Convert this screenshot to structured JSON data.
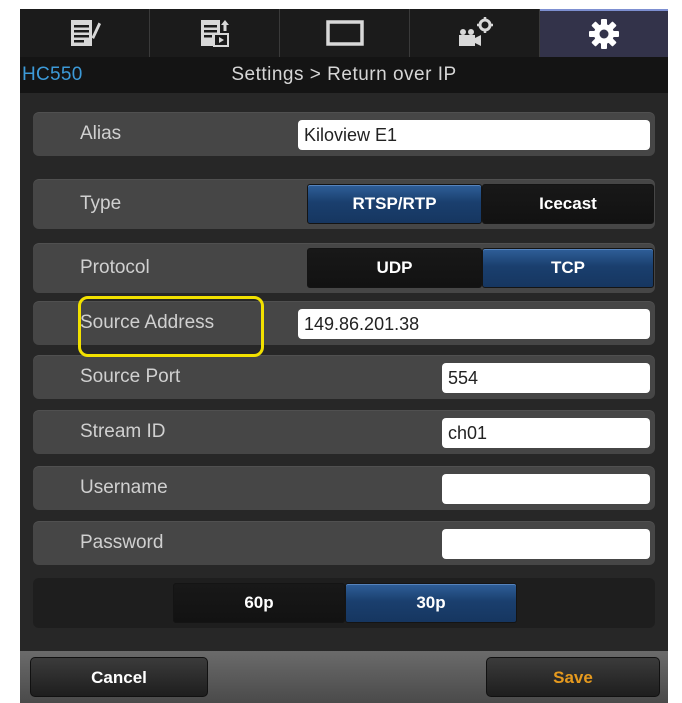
{
  "tabs": [
    {
      "icon": "list-edit-icon"
    },
    {
      "icon": "list-export-icon"
    },
    {
      "icon": "monitor-icon"
    },
    {
      "icon": "camera-settings-icon"
    },
    {
      "icon": "gear-icon",
      "active": true
    }
  ],
  "header": {
    "model": "HC550",
    "title": "Settings > Return over IP"
  },
  "fields": {
    "alias": {
      "label": "Alias",
      "value": "Kiloview E1"
    },
    "type": {
      "label": "Type",
      "options": [
        "RTSP/RTP",
        "Icecast"
      ],
      "selected": "RTSP/RTP"
    },
    "protocol": {
      "label": "Protocol",
      "options": [
        "UDP",
        "TCP"
      ],
      "selected": "TCP"
    },
    "source_address": {
      "label": "Source Address",
      "value": "149.86.201.38"
    },
    "source_port": {
      "label": "Source Port",
      "value": "554"
    },
    "stream_id": {
      "label": "Stream ID",
      "value": "ch01"
    },
    "username": {
      "label": "Username",
      "value": ""
    },
    "password": {
      "label": "Password",
      "value": ""
    }
  },
  "frame_rate": {
    "options": [
      "60p",
      "30p"
    ],
    "selected": "30p"
  },
  "buttons": {
    "cancel": "Cancel",
    "save": "Save"
  },
  "colors": {
    "accent": "#3c9ad8",
    "save": "#e69a1e",
    "highlight": "#f2e100"
  }
}
